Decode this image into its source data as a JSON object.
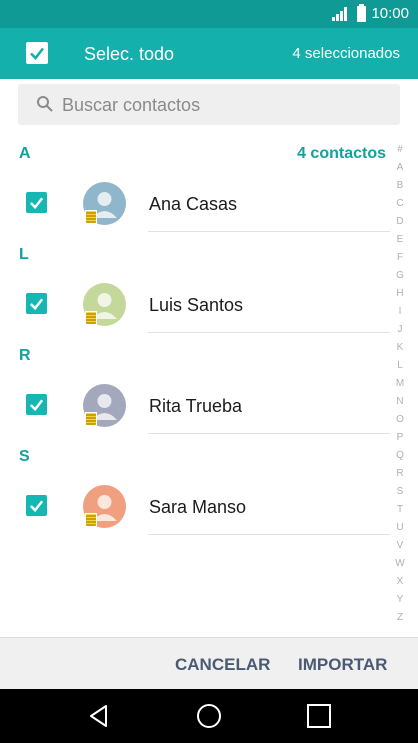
{
  "status_bar": {
    "time": "10:00",
    "signal_icon": "signal-icon",
    "battery_icon": "battery-icon"
  },
  "app_bar": {
    "select_all_label": "Selec. todo",
    "selected_count": "4 seleccionados",
    "accent": "#14b0ab"
  },
  "search": {
    "placeholder": "Buscar contactos",
    "icon": "search-icon"
  },
  "sections": [
    {
      "letter": "A",
      "count_label": "4 contactos",
      "contacts": [
        {
          "name": "Ana Casas",
          "checked": true,
          "avatar_color": "#8fb6cb"
        }
      ]
    },
    {
      "letter": "L",
      "contacts": [
        {
          "name": "Luis Santos",
          "checked": true,
          "avatar_color": "#c4d89c"
        }
      ]
    },
    {
      "letter": "R",
      "contacts": [
        {
          "name": "Rita Trueba",
          "checked": true,
          "avatar_color": "#a4a8bd"
        }
      ]
    },
    {
      "letter": "S",
      "contacts": [
        {
          "name": "Sara Manso",
          "checked": true,
          "avatar_color": "#f0a07e"
        }
      ]
    }
  ],
  "alphabet_index": [
    "#",
    "A",
    "B",
    "C",
    "D",
    "E",
    "F",
    "G",
    "H",
    "I",
    "J",
    "K",
    "L",
    "M",
    "N",
    "O",
    "P",
    "Q",
    "R",
    "S",
    "T",
    "U",
    "V",
    "W",
    "X",
    "Y",
    "Z"
  ],
  "actions": {
    "cancel": "CANCELAR",
    "import": "IMPORTAR"
  },
  "nav": {
    "back_icon": "back-icon",
    "home_icon": "home-icon",
    "recents_icon": "recents-icon"
  }
}
